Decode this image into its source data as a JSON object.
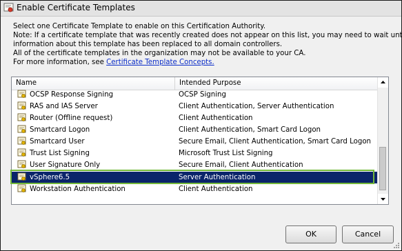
{
  "window": {
    "title": "Enable Certificate Templates"
  },
  "intro": {
    "line1": "Select one Certificate Template to enable on this Certification Authority.",
    "line2": "Note: If a certificate template that was recently created does not appear on this list, you may need to wait until",
    "line3": "information about this template has been replaced to all domain controllers.",
    "line4": "All of the certificate templates in the organization may not be available to your CA.",
    "line5_prefix": "For more information, see ",
    "line5_link": "Certificate Template Concepts."
  },
  "list": {
    "columns": {
      "name": "Name",
      "purpose": "Intended Purpose"
    },
    "rows": [
      {
        "name": "OCSP Response Signing",
        "purpose": "OCSP Signing"
      },
      {
        "name": "RAS and IAS Server",
        "purpose": "Client Authentication, Server Authentication"
      },
      {
        "name": "Router (Offline request)",
        "purpose": "Client Authentication"
      },
      {
        "name": "Smartcard Logon",
        "purpose": "Client Authentication, Smart Card Logon"
      },
      {
        "name": "Smartcard User",
        "purpose": "Secure Email, Client Authentication, Smart Card Logon"
      },
      {
        "name": "Trust List Signing",
        "purpose": "Microsoft Trust List Signing"
      },
      {
        "name": "User Signature Only",
        "purpose": "Secure Email, Client Authentication"
      },
      {
        "name": "vSphere6.5",
        "purpose": "Server Authentication"
      },
      {
        "name": "Workstation Authentication",
        "purpose": "Client Authentication"
      }
    ]
  },
  "buttons": {
    "ok": "OK",
    "cancel": "Cancel"
  },
  "colors": {
    "selection": "#0a246a",
    "highlight_border": "#74b83a",
    "link": "#0b2dc8"
  }
}
